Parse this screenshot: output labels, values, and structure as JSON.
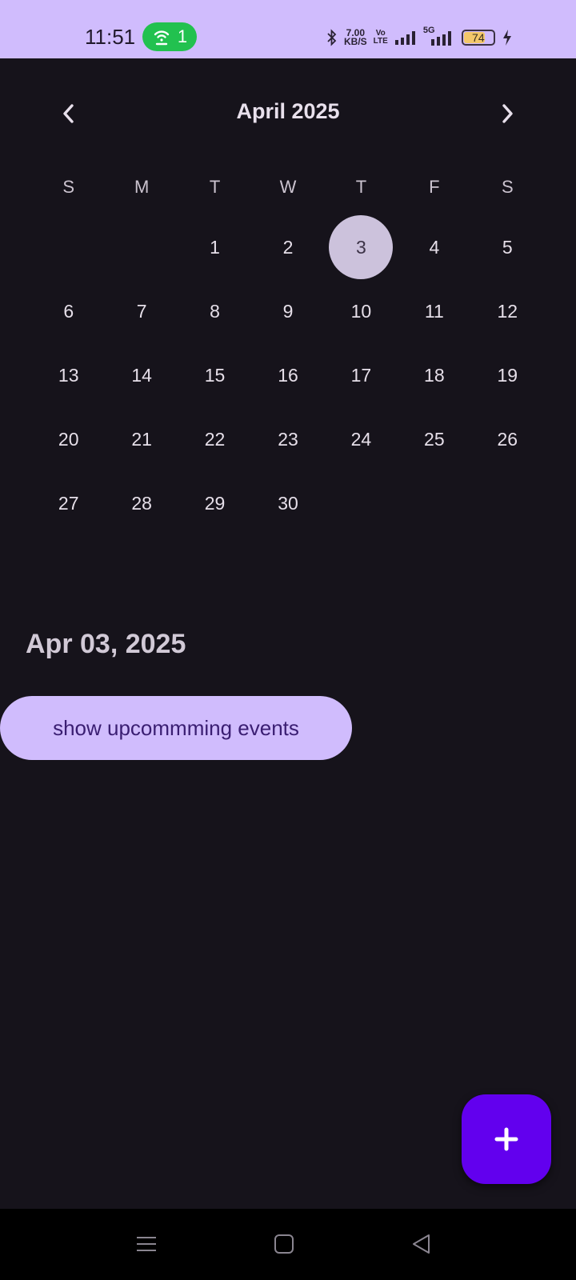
{
  "status_bar": {
    "time": "11:51",
    "hotspot_count": "1",
    "net_speed_value": "7.00",
    "net_speed_unit": "KB/S",
    "volte_top": "Vo",
    "volte_bottom": "LTE",
    "network_5g": "5G",
    "battery": "74",
    "battery_level": 0.74
  },
  "calendar": {
    "month_title": "April 2025",
    "weekdays": [
      "S",
      "M",
      "T",
      "W",
      "T",
      "F",
      "S"
    ],
    "leading_blanks": 2,
    "days": [
      "1",
      "2",
      "3",
      "4",
      "5",
      "6",
      "7",
      "8",
      "9",
      "10",
      "11",
      "12",
      "13",
      "14",
      "15",
      "16",
      "17",
      "18",
      "19",
      "20",
      "21",
      "22",
      "23",
      "24",
      "25",
      "26",
      "27",
      "28",
      "29",
      "30"
    ],
    "selected_day": "3"
  },
  "selected_date": "Apr 03, 2025",
  "upcoming_button_label": "show upcommming events",
  "colors": {
    "accent": "#d0bcfd",
    "fab": "#6200ee",
    "background": "#16131b",
    "selected_circle": "#ccc2dc",
    "hotspot_green": "#22c14f"
  },
  "icons": {
    "prev": "chevron-left-icon",
    "next": "chevron-right-icon",
    "fab": "plus-icon",
    "nav_menu": "menu-icon",
    "nav_home": "home-icon",
    "nav_back": "back-icon"
  }
}
